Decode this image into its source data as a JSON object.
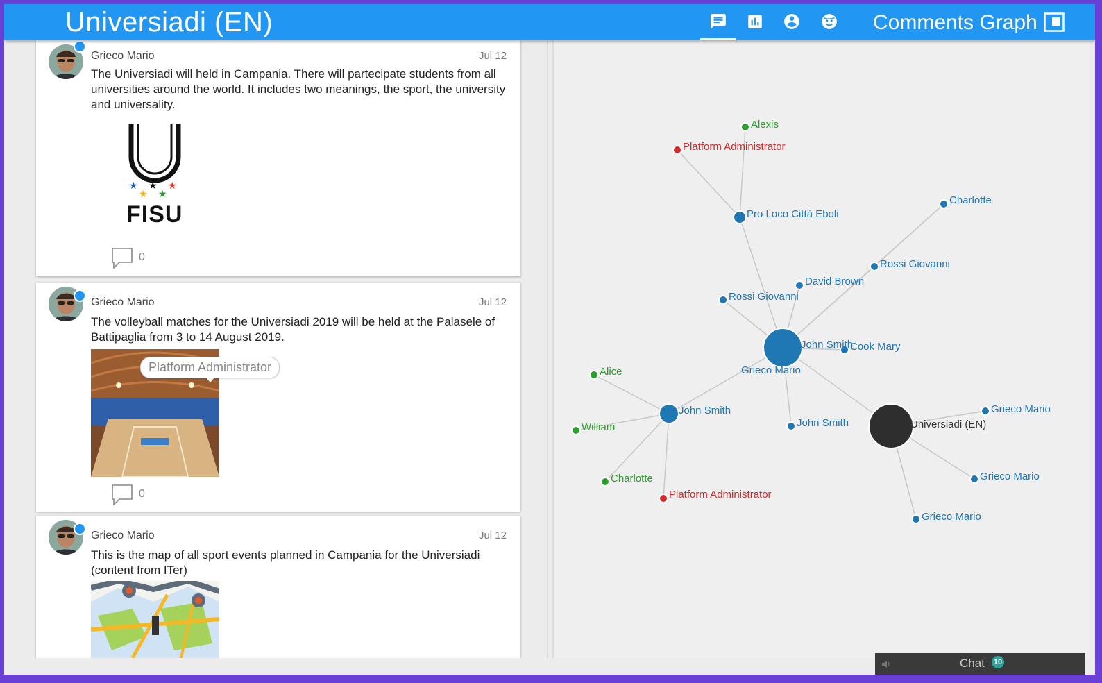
{
  "app": {
    "title": "Universiadi (EN)"
  },
  "nav": {
    "items": [
      "posts",
      "stats",
      "profile",
      "emoji"
    ],
    "active": "posts",
    "graph_title": "Comments Graph"
  },
  "posts": [
    {
      "author": "Grieco Mario",
      "date": "Jul 12",
      "text": "The Universiadi will held in Campania. There will partecipate students from all universities around the world. It includes two meanings, the sport, the university and universality.",
      "logo_text": "FISU",
      "comments": "0"
    },
    {
      "author": "Grieco Mario",
      "date": "Jul 12",
      "text": "The volleyball matches for the Universiadi 2019 will be held at the Palasele of Battipaglia from 3 to 14 August 2019.",
      "tooltip": "Platform Administrator",
      "comments": "0"
    },
    {
      "author": "Grieco Mario",
      "date": "Jul 12",
      "text": "This is the map of all sport events planned in Campania for the Universiadi (content from ITer)"
    }
  ],
  "graph": {
    "colors": {
      "blue": "#1f77b4",
      "green": "#2ca02c",
      "red": "#d62728",
      "dark": "#2e2e2e",
      "edge": "#c8c8c8"
    },
    "nodes": [
      {
        "id": "alexis",
        "label": "Alexis",
        "color": "green"
      },
      {
        "id": "admin1",
        "label": "Platform Administrator",
        "color": "red"
      },
      {
        "id": "proloco",
        "label": "Pro Loco Città Eboli",
        "color": "blue"
      },
      {
        "id": "charlotte1",
        "label": "Charlotte",
        "color": "blue"
      },
      {
        "id": "rossi1",
        "label": "Rossi Giovanni",
        "color": "blue"
      },
      {
        "id": "david",
        "label": "David Brown",
        "color": "blue"
      },
      {
        "id": "rossi2",
        "label": "Rossi Giovanni",
        "color": "blue"
      },
      {
        "id": "johnsmith1",
        "label": "John Smith",
        "color": "blue"
      },
      {
        "id": "cook",
        "label": "Cook Mary",
        "color": "blue"
      },
      {
        "id": "grieco_hub",
        "label": "Grieco Mario",
        "color": "blue"
      },
      {
        "id": "alice",
        "label": "Alice",
        "color": "green"
      },
      {
        "id": "johnsmith2",
        "label": "John Smith",
        "color": "blue"
      },
      {
        "id": "william",
        "label": "William",
        "color": "green"
      },
      {
        "id": "johnsmith3",
        "label": "John Smith",
        "color": "blue"
      },
      {
        "id": "universiadi",
        "label": "Universiadi (EN)",
        "color": "dark"
      },
      {
        "id": "grieco1",
        "label": "Grieco Mario",
        "color": "blue"
      },
      {
        "id": "grieco2",
        "label": "Grieco Mario",
        "color": "blue"
      },
      {
        "id": "grieco3",
        "label": "Grieco Mario",
        "color": "blue"
      },
      {
        "id": "charlotte2",
        "label": "Charlotte",
        "color": "green"
      },
      {
        "id": "admin2",
        "label": "Platform Administrator",
        "color": "red"
      }
    ],
    "edges": [
      [
        "alexis",
        "proloco"
      ],
      [
        "admin1",
        "proloco"
      ],
      [
        "proloco",
        "grieco_hub"
      ],
      [
        "charlotte1",
        "grieco_hub"
      ],
      [
        "david",
        "grieco_hub"
      ],
      [
        "rossi2",
        "grieco_hub"
      ],
      [
        "cook",
        "grieco_hub"
      ],
      [
        "johnsmith2",
        "grieco_hub"
      ],
      [
        "johnsmith3",
        "grieco_hub"
      ],
      [
        "universiadi",
        "grieco_hub"
      ],
      [
        "alice",
        "johnsmith2"
      ],
      [
        "william",
        "johnsmith2"
      ],
      [
        "charlotte2",
        "johnsmith2"
      ],
      [
        "admin2",
        "johnsmith2"
      ],
      [
        "grieco1",
        "universiadi"
      ],
      [
        "grieco2",
        "universiadi"
      ],
      [
        "grieco3",
        "universiadi"
      ]
    ]
  },
  "chat": {
    "label": "Chat",
    "count": "10"
  }
}
